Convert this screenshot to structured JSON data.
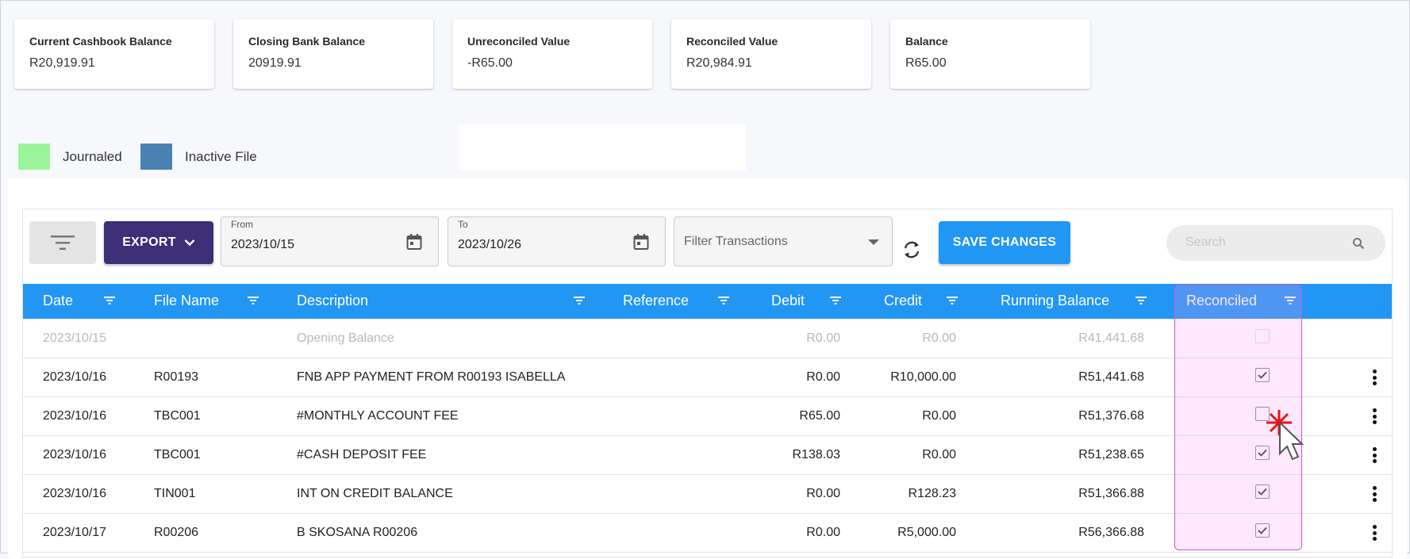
{
  "summary_cards": [
    {
      "label": "Current Cashbook Balance",
      "value": "R20,919.91"
    },
    {
      "label": "Closing Bank Balance",
      "value": "20919.91"
    },
    {
      "label": "Unreconciled Value",
      "value": "-R65.00"
    },
    {
      "label": "Reconciled Value",
      "value": "R20,984.91"
    },
    {
      "label": "Balance",
      "value": "R65.00"
    }
  ],
  "legend": [
    {
      "label": "Journaled",
      "color": "#9af59a"
    },
    {
      "label": "Inactive File",
      "color": "#4a82b4"
    }
  ],
  "toolbar": {
    "export_label": "EXPORT",
    "from_label": "From",
    "from_value": "2023/10/15",
    "to_label": "To",
    "to_value": "2023/10/26",
    "filter_placeholder": "Filter Transactions",
    "save_label": "SAVE CHANGES",
    "search_placeholder": "Search"
  },
  "table": {
    "columns": [
      "Date",
      "File Name",
      "Description",
      "Reference",
      "Debit",
      "Credit",
      "Running Balance",
      "Reconciled"
    ],
    "rows": [
      {
        "date": "2023/10/15",
        "file": "",
        "description": "Opening Balance",
        "reference": "",
        "debit": "R0.00",
        "credit": "R0.00",
        "balance": "R41,441.68",
        "reconciled": false,
        "dim": true
      },
      {
        "date": "2023/10/16",
        "file": "R00193",
        "description": "FNB APP PAYMENT FROM R00193 ISABELLA",
        "reference": "",
        "debit": "R0.00",
        "credit": "R10,000.00",
        "balance": "R51,441.68",
        "reconciled": true,
        "dim": false
      },
      {
        "date": "2023/10/16",
        "file": "TBC001",
        "description": "#MONTHLY ACCOUNT FEE",
        "reference": "",
        "debit": "R65.00",
        "credit": "R0.00",
        "balance": "R51,376.68",
        "reconciled": false,
        "dim": false
      },
      {
        "date": "2023/10/16",
        "file": "TBC001",
        "description": "#CASH DEPOSIT FEE",
        "reference": "",
        "debit": "R138.03",
        "credit": "R0.00",
        "balance": "R51,238.65",
        "reconciled": true,
        "dim": false
      },
      {
        "date": "2023/10/16",
        "file": "TIN001",
        "description": "INT ON CREDIT BALANCE",
        "reference": "",
        "debit": "R0.00",
        "credit": "R128.23",
        "balance": "R51,366.88",
        "reconciled": true,
        "dim": false
      },
      {
        "date": "2023/10/17",
        "file": "R00206",
        "description": "B SKOSANA R00206",
        "reference": "",
        "debit": "R0.00",
        "credit": "R5,000.00",
        "balance": "R56,366.88",
        "reconciled": true,
        "dim": false
      }
    ]
  },
  "colors": {
    "header_blue": "#2196f3",
    "export_purple": "#3d2e78",
    "highlight": "#c45ad1"
  }
}
